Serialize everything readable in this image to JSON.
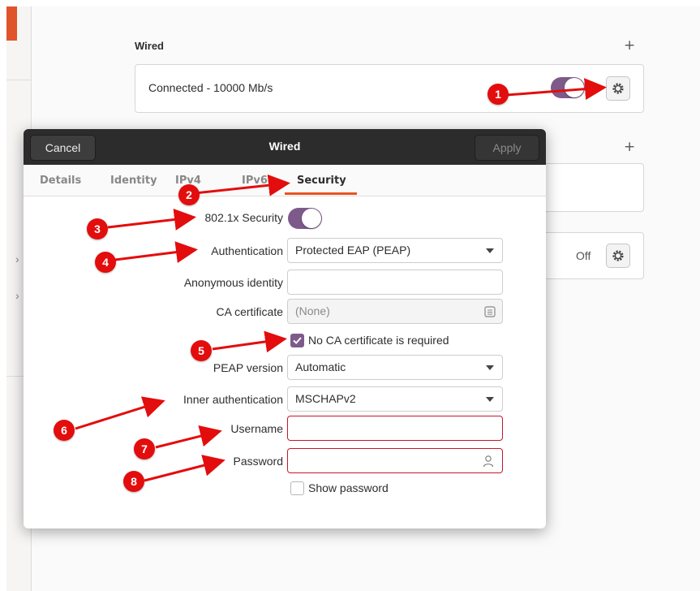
{
  "background": {
    "wired_section_title": "Wired",
    "connection_status": "Connected - 10000 Mb/s",
    "second_row_status": "Off",
    "plus_symbol": "+"
  },
  "dialog": {
    "cancel_label": "Cancel",
    "title": "Wired",
    "apply_label": "Apply",
    "tabs": [
      {
        "label": "Details"
      },
      {
        "label": "Identity"
      },
      {
        "label": "IPv4"
      },
      {
        "label": "IPv6"
      },
      {
        "label": "Security"
      }
    ],
    "active_tab": "Security",
    "form": {
      "security_label": "802.1x Security",
      "security_enabled": true,
      "authentication_label": "Authentication",
      "authentication_value": "Protected EAP (PEAP)",
      "anonymous_identity_label": "Anonymous identity",
      "anonymous_identity_value": "",
      "ca_certificate_label": "CA certificate",
      "ca_certificate_value": "(None)",
      "no_ca_label": "No CA certificate is required",
      "no_ca_checked": true,
      "peap_version_label": "PEAP version",
      "peap_version_value": "Automatic",
      "inner_auth_label": "Inner authentication",
      "inner_auth_value": "MSCHAPv2",
      "username_label": "Username",
      "username_value": "",
      "password_label": "Password",
      "password_value": "",
      "show_password_label": "Show password",
      "show_password_checked": false
    }
  },
  "annotations": [
    "1",
    "2",
    "3",
    "4",
    "5",
    "6",
    "7",
    "8"
  ],
  "colors": {
    "accent_purple": "#7e5a8b",
    "sidebar_orange": "#e0542b",
    "annotation_red": "#e30d0d",
    "error_red": "#c7162b",
    "tab_underline": "#e95420",
    "titlebar": "#2c2c2c"
  }
}
